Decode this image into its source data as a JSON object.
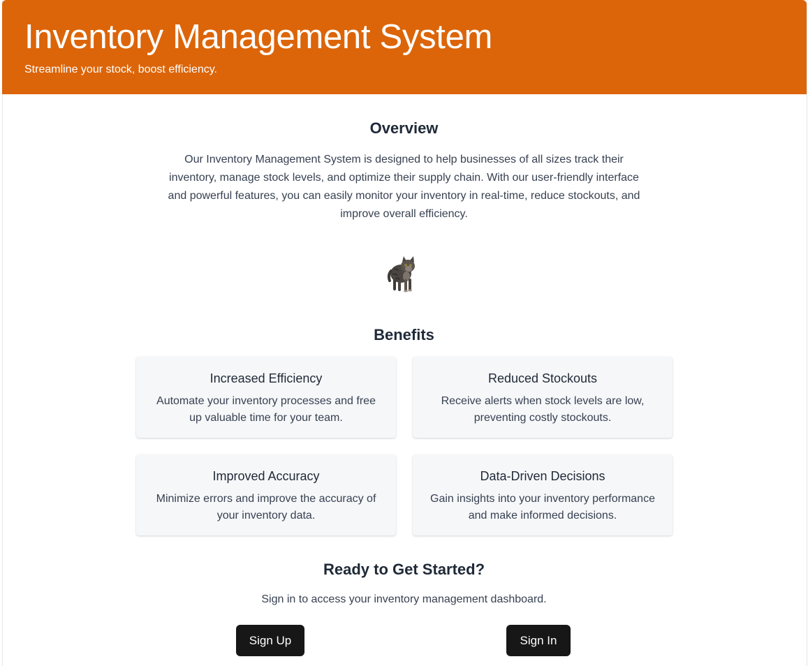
{
  "header": {
    "title": "Inventory Management System",
    "subtitle": "Streamline your stock, boost efficiency."
  },
  "overview": {
    "heading": "Overview",
    "text": "Our Inventory Management System is designed to help businesses of all sizes track their inventory, manage stock levels, and optimize their supply chain. With our user-friendly interface and powerful features, you can easily monitor your inventory in real-time, reduce stockouts, and improve overall efficiency."
  },
  "image": {
    "icon": "cat-image"
  },
  "benefits": {
    "heading": "Benefits",
    "items": [
      {
        "title": "Increased Efficiency",
        "text": "Automate your inventory processes and free up valuable time for your team."
      },
      {
        "title": "Reduced Stockouts",
        "text": "Receive alerts when stock levels are low, preventing costly stockouts."
      },
      {
        "title": "Improved Accuracy",
        "text": "Minimize errors and improve the accuracy of your inventory data."
      },
      {
        "title": "Data-Driven Decisions",
        "text": "Gain insights into your inventory performance and make informed decisions."
      }
    ]
  },
  "cta": {
    "heading": "Ready to Get Started?",
    "text": "Sign in to access your inventory management dashboard.",
    "signup_label": "Sign Up",
    "signin_label": "Sign In"
  },
  "colors": {
    "header_bg": "#dc6509",
    "button_bg": "#171717",
    "card_bg": "#f6f7f9"
  }
}
